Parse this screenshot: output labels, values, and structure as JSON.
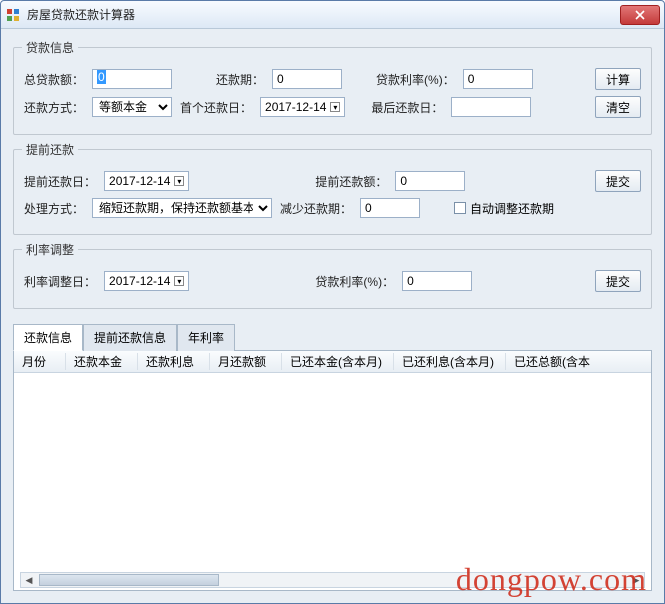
{
  "window": {
    "title": "房屋贷款还款计算器"
  },
  "loan": {
    "legend": "贷款信息",
    "total_label": "总贷款额：",
    "total_value": "0",
    "periods_label": "还款期：",
    "periods_value": "0",
    "rate_label": "贷款利率(%)：",
    "rate_value": "0",
    "calc_btn": "计算",
    "clear_btn": "清空",
    "method_label": "还款方式：",
    "method_value": "等额本金",
    "first_date_label": "首个还款日：",
    "first_date_value": "2017-12-14",
    "last_date_label": "最后还款日：",
    "last_date_value": ""
  },
  "prepay": {
    "legend": "提前还款",
    "date_label": "提前还款日：",
    "date_value": "2017-12-14",
    "amount_label": "提前还款额：",
    "amount_value": "0",
    "submit_btn": "提交",
    "handle_label": "处理方式：",
    "handle_value": "缩短还款期，保持还款额基本不变",
    "reduce_label": "减少还款期：",
    "reduce_value": "0",
    "auto_adjust": "自动调整还款期"
  },
  "rate_adjust": {
    "legend": "利率调整",
    "date_label": "利率调整日：",
    "date_value": "2017-12-14",
    "rate_label": "贷款利率(%)：",
    "rate_value": "0",
    "submit_btn": "提交"
  },
  "tabs": {
    "t1": "还款信息",
    "t2": "提前还款信息",
    "t3": "年利率"
  },
  "columns": {
    "c0": "月份",
    "c1": "还款本金",
    "c2": "还款利息",
    "c3": "月还款额",
    "c4": "已还本金(含本月)",
    "c5": "已还利息(含本月)",
    "c6": "已还总额(含本"
  },
  "watermark": "dongpow.com"
}
